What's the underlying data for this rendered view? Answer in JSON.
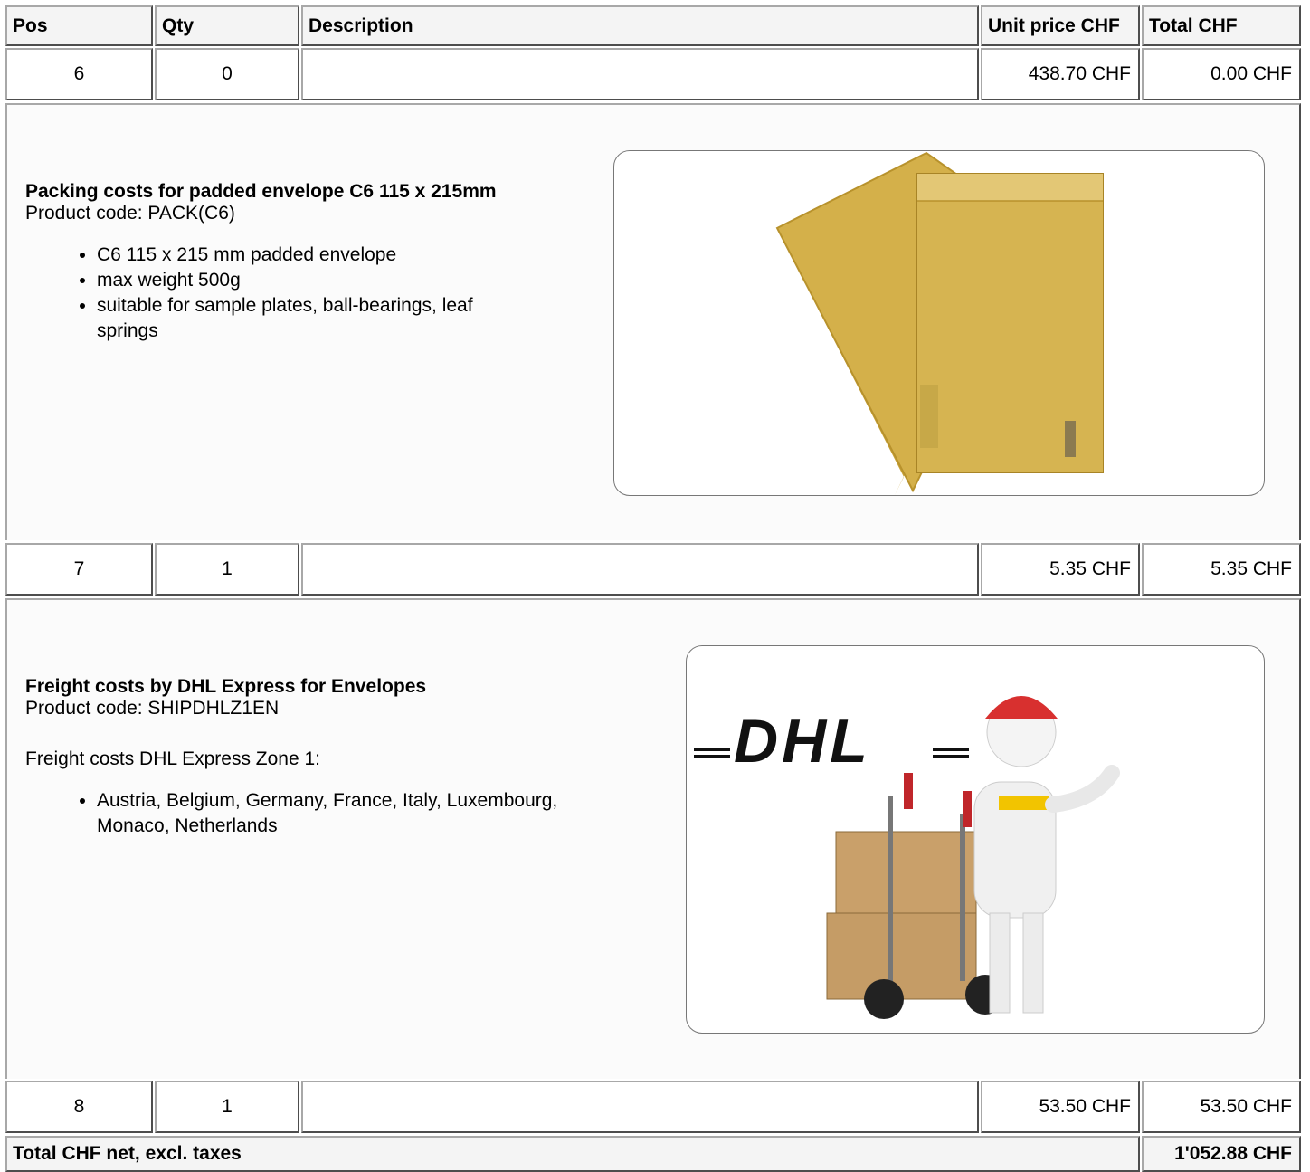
{
  "headers": {
    "pos": "Pos",
    "qty": "Qty",
    "description": "Description",
    "unit_price": "Unit price CHF",
    "total": "Total CHF"
  },
  "rows": [
    {
      "pos": "6",
      "qty": "0",
      "unit_price": "438.70 CHF",
      "total": "0.00 CHF"
    },
    {
      "pos": "7",
      "qty": "1",
      "unit_price": "5.35 CHF",
      "total": "5.35 CHF"
    },
    {
      "pos": "8",
      "qty": "1",
      "unit_price": "53.50 CHF",
      "total": "53.50 CHF"
    }
  ],
  "items": [
    {
      "title": "Packing costs for padded envelope C6 115 x 215mm",
      "product_code": "Product code: PACK(C6)",
      "bullets": [
        "C6 115 x 215 mm padded envelope",
        "max weight 500g",
        "suitable for sample plates, ball-bearings, leaf springs"
      ],
      "image": "padded-envelope-photo"
    },
    {
      "title": "Freight costs by DHL Express for Envelopes",
      "product_code": "Product code: SHIPDHLZ1EN",
      "intro": "Freight costs DHL Express Zone 1:",
      "bullets": [
        "Austria, Belgium, Germany, France, Italy, Luxembourg, Monaco, Netherlands"
      ],
      "image": "dhl-courier-illustration",
      "logo_text": "DHL"
    }
  ],
  "footer": {
    "label": "Total CHF net, excl. taxes",
    "value": "1'052.88 CHF"
  }
}
